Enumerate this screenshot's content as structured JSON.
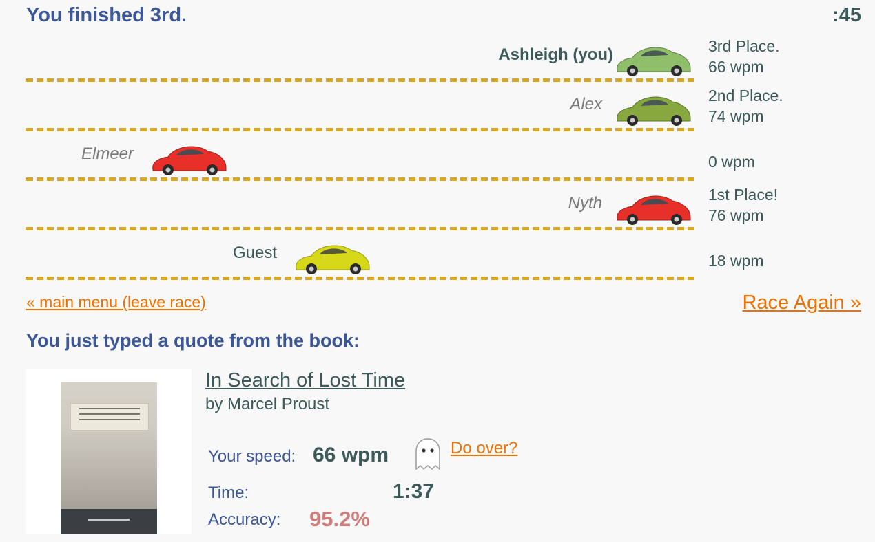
{
  "header": {
    "result": "You finished 3rd.",
    "timer": ":45"
  },
  "racers": [
    {
      "name": "Ashleigh (you)",
      "place": "3rd Place.",
      "wpm": "66 wpm",
      "car_color": "#8fbf6a"
    },
    {
      "name": "Alex",
      "place": "2nd Place.",
      "wpm": "74 wpm",
      "car_color": "#86a83e"
    },
    {
      "name": "Elmeer",
      "place": "",
      "wpm": "0 wpm",
      "car_color": "#e8302a"
    },
    {
      "name": "Nyth",
      "place": "1st Place!",
      "wpm": "76 wpm",
      "car_color": "#e8302a"
    },
    {
      "name": "Guest",
      "place": "",
      "wpm": "18 wpm",
      "car_color": "#d7d81a"
    }
  ],
  "links": {
    "leave": "« main menu (leave race)",
    "race_again": "Race Again »"
  },
  "quote": {
    "heading": "You just typed a quote from the book:",
    "book_title": "In Search of Lost Time",
    "author": "by Marcel Proust"
  },
  "results": {
    "speed_label": "Your speed:",
    "speed_value": "66 wpm",
    "do_over": "Do over?",
    "time_label": "Time:",
    "time_value": "1:37",
    "accuracy_label": "Accuracy:",
    "accuracy_value": "95.2%"
  },
  "icons": {
    "car": "car-icon",
    "ghost": "ghost-icon",
    "book_cover": "book-cover-image"
  }
}
